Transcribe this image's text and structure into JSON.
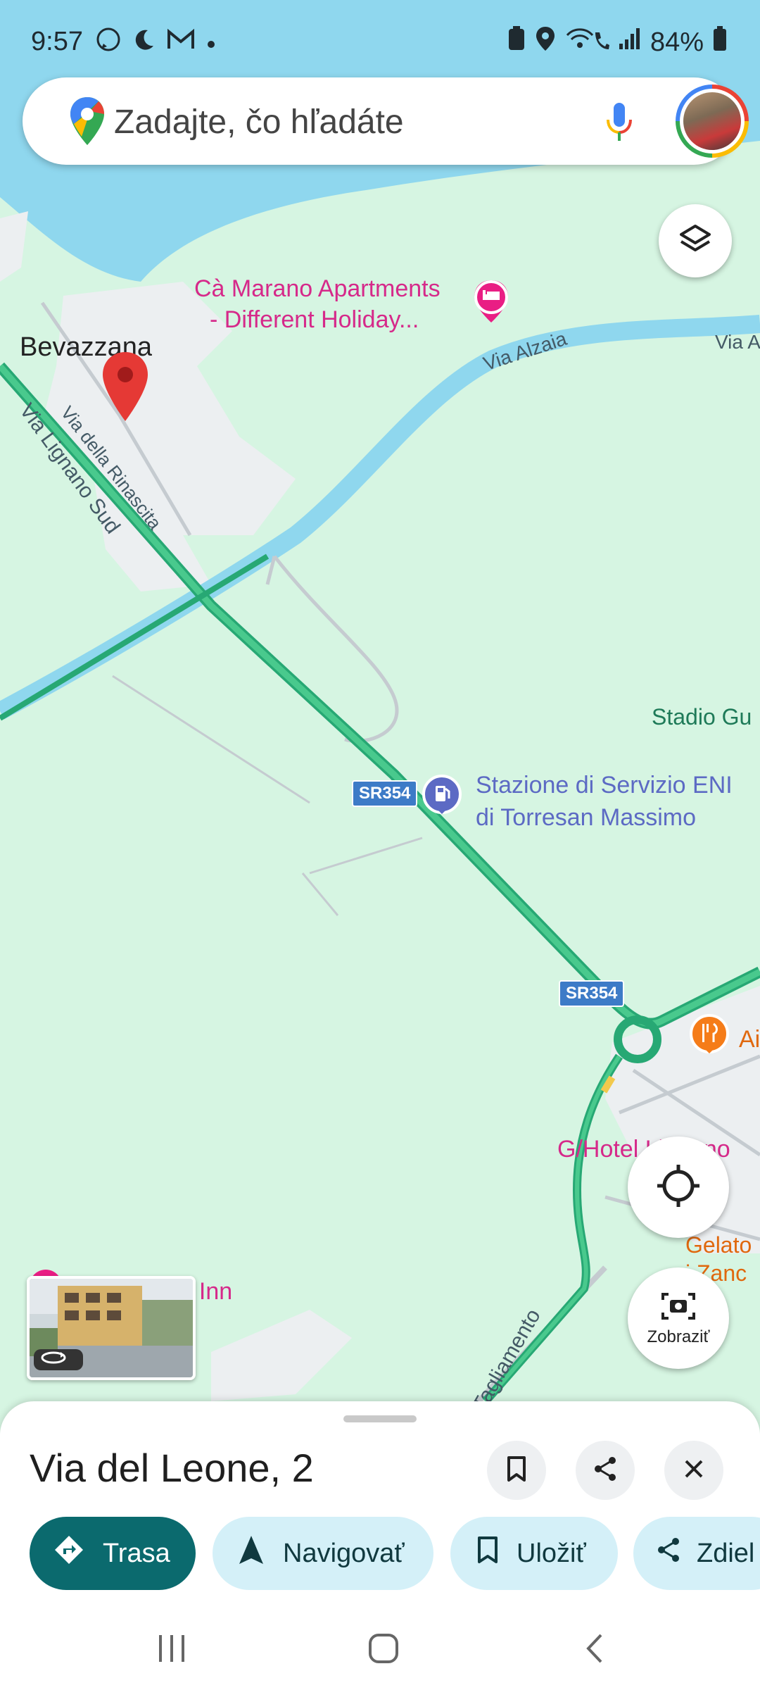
{
  "status_bar": {
    "time": "9:57",
    "battery": "84%",
    "left_icons": [
      "whatsapp-icon",
      "moon-icon",
      "gmail-icon",
      "dot-icon"
    ],
    "right_icons": [
      "battery-saver-icon",
      "location-icon",
      "wifi-call-icon",
      "signal-icon",
      "battery-icon"
    ]
  },
  "search": {
    "placeholder": "Zadajte, čo hľadáte"
  },
  "map": {
    "labels": {
      "bevazzana": "Bevazzana",
      "ca_marano_line1": "Cà Marano Apartments",
      "ca_marano_line2": "- Different Holiday...",
      "via_alzaia": "Via Alzaia",
      "via_alzaia_edge": "Via A",
      "via_lignano_sud": "Via Lignano Sud",
      "via_rinascita": "Via della Rinascita",
      "stadio": "Stadio Gu",
      "eni_line1": "Stazione di Servizio ENI",
      "eni_line2": "di Torresan Massimo",
      "sr354_a": "SR354",
      "sr354_b": "SR354",
      "restaurant_edge": "Ai",
      "hotel": "G/Hotel Lignano",
      "gelato_line1": "Gelato",
      "gelato_line2": "i Zanc",
      "inn": "f Inn",
      "tagliamento": "Tagliamento"
    },
    "camera_button_label": "Zobraziť"
  },
  "sheet": {
    "title": "Via del Leone, 2",
    "actions": {
      "route": "Trasa",
      "navigate": "Navigovať",
      "save": "Uložiť",
      "share": "Zdiel"
    }
  },
  "colors": {
    "map_land": "#d6f5e2",
    "water": "#8fd7ee",
    "road_main": "#3cbd87",
    "primary_chip": "#0b6a6e",
    "chip": "#d4f0f8",
    "pin_red": "#e53935"
  }
}
